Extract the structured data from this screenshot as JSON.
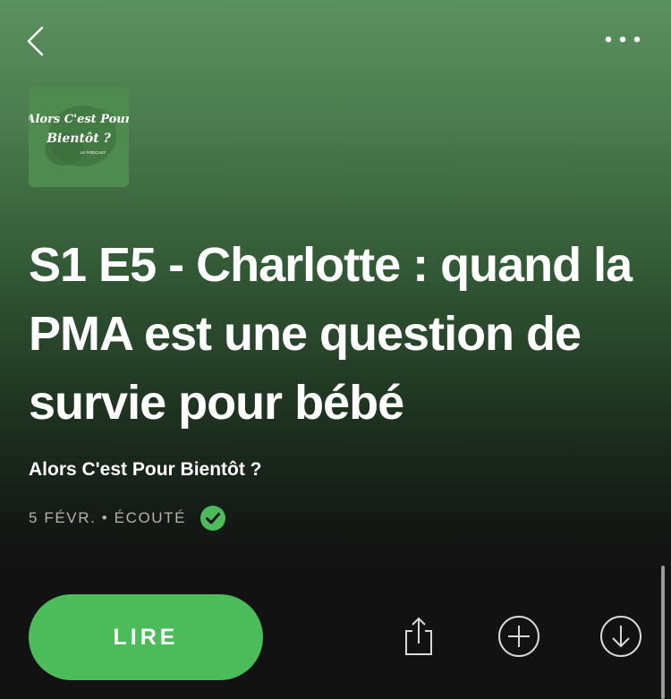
{
  "header": {
    "back_icon": "chevron-left-icon",
    "more_icon": "ellipsis-icon"
  },
  "cover": {
    "line1": "Alors C'est Pour",
    "line2": "Bientôt ?",
    "line3": "LE PODCAST"
  },
  "episode": {
    "title": "S1 E5 - Charlotte : quand la PMA est une question de survie pour bébé",
    "show": "Alors C'est Pour Bientôt ?",
    "meta": "5 FÉVR. • ÉCOUTÉ"
  },
  "actions": {
    "play_label": "LIRE",
    "share_icon": "share-icon",
    "add_icon": "add-circle-icon",
    "download_icon": "download-icon"
  },
  "colors": {
    "accent": "#4cbc5b",
    "header_gradient_top": "#5c9160",
    "background": "#121212",
    "meta_text": "#b3b3b3"
  }
}
